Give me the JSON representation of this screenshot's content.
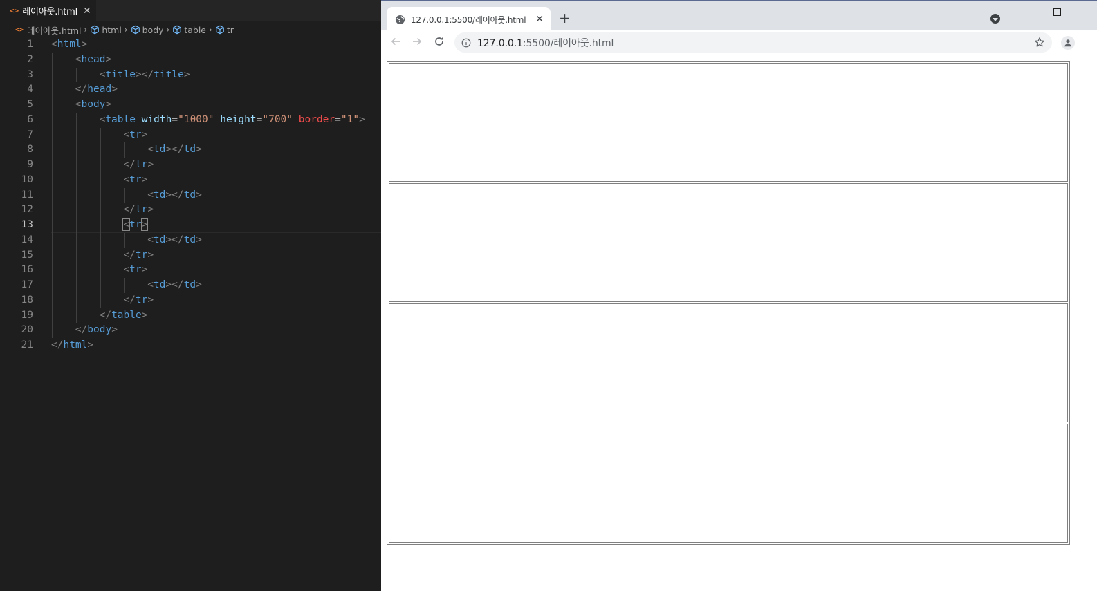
{
  "editor": {
    "tab": {
      "label": "레이아웃.html",
      "icon": "html-file-icon"
    },
    "breadcrumb": {
      "file": "레이아웃.html",
      "items": [
        "html",
        "body",
        "table",
        "tr"
      ]
    },
    "active_line": 13,
    "lines": [
      {
        "n": "1",
        "indent": 0,
        "tokens": [
          [
            "br",
            "<"
          ],
          [
            "tag",
            "html"
          ],
          [
            "br",
            ">"
          ]
        ]
      },
      {
        "n": "2",
        "indent": 1,
        "tokens": [
          [
            "br",
            "<"
          ],
          [
            "tag",
            "head"
          ],
          [
            "br",
            ">"
          ]
        ]
      },
      {
        "n": "3",
        "indent": 2,
        "tokens": [
          [
            "br",
            "<"
          ],
          [
            "tag",
            "title"
          ],
          [
            "br",
            "></"
          ],
          [
            "tag",
            "title"
          ],
          [
            "br",
            ">"
          ]
        ]
      },
      {
        "n": "4",
        "indent": 1,
        "tokens": [
          [
            "br",
            "</"
          ],
          [
            "tag",
            "head"
          ],
          [
            "br",
            ">"
          ]
        ]
      },
      {
        "n": "5",
        "indent": 1,
        "tokens": [
          [
            "br",
            "<"
          ],
          [
            "tag",
            "body"
          ],
          [
            "br",
            ">"
          ]
        ]
      },
      {
        "n": "6",
        "indent": 2,
        "tokens": [
          [
            "br",
            "<"
          ],
          [
            "tag",
            "table"
          ],
          [
            "sp",
            " "
          ],
          [
            "attr",
            "width"
          ],
          [
            "eq",
            "="
          ],
          [
            "val",
            "\"1000\""
          ],
          [
            "sp",
            " "
          ],
          [
            "attr",
            "height"
          ],
          [
            "eq",
            "="
          ],
          [
            "val",
            "\"700\""
          ],
          [
            "sp",
            " "
          ],
          [
            "attr-r",
            "border"
          ],
          [
            "eq",
            "="
          ],
          [
            "val",
            "\"1\""
          ],
          [
            "br",
            ">"
          ]
        ]
      },
      {
        "n": "7",
        "indent": 3,
        "tokens": [
          [
            "br",
            "<"
          ],
          [
            "tag",
            "tr"
          ],
          [
            "br",
            ">"
          ]
        ]
      },
      {
        "n": "8",
        "indent": 4,
        "tokens": [
          [
            "br",
            "<"
          ],
          [
            "tag",
            "td"
          ],
          [
            "br",
            "></"
          ],
          [
            "tag",
            "td"
          ],
          [
            "br",
            ">"
          ]
        ]
      },
      {
        "n": "9",
        "indent": 3,
        "tokens": [
          [
            "br",
            "</"
          ],
          [
            "tag",
            "tr"
          ],
          [
            "br",
            ">"
          ]
        ]
      },
      {
        "n": "10",
        "indent": 3,
        "tokens": [
          [
            "br",
            "<"
          ],
          [
            "tag",
            "tr"
          ],
          [
            "br",
            ">"
          ]
        ]
      },
      {
        "n": "11",
        "indent": 4,
        "tokens": [
          [
            "br",
            "<"
          ],
          [
            "tag",
            "td"
          ],
          [
            "br",
            "></"
          ],
          [
            "tag",
            "td"
          ],
          [
            "br",
            ">"
          ]
        ]
      },
      {
        "n": "12",
        "indent": 3,
        "tokens": [
          [
            "br",
            "</"
          ],
          [
            "tag",
            "tr"
          ],
          [
            "br",
            ">"
          ]
        ]
      },
      {
        "n": "13",
        "indent": 3,
        "tokens": [
          [
            "hbr",
            "<"
          ],
          [
            "tag",
            "tr"
          ],
          [
            "hbr",
            ">"
          ]
        ]
      },
      {
        "n": "14",
        "indent": 4,
        "tokens": [
          [
            "br",
            "<"
          ],
          [
            "tag",
            "td"
          ],
          [
            "br",
            "></"
          ],
          [
            "tag",
            "td"
          ],
          [
            "br",
            ">"
          ]
        ]
      },
      {
        "n": "15",
        "indent": 3,
        "tokens": [
          [
            "br",
            "</"
          ],
          [
            "tag",
            "tr"
          ],
          [
            "br",
            ">"
          ]
        ]
      },
      {
        "n": "16",
        "indent": 3,
        "tokens": [
          [
            "br",
            "<"
          ],
          [
            "tag",
            "tr"
          ],
          [
            "br",
            ">"
          ]
        ]
      },
      {
        "n": "17",
        "indent": 4,
        "tokens": [
          [
            "br",
            "<"
          ],
          [
            "tag",
            "td"
          ],
          [
            "br",
            "></"
          ],
          [
            "tag",
            "td"
          ],
          [
            "br",
            ">"
          ]
        ]
      },
      {
        "n": "18",
        "indent": 3,
        "tokens": [
          [
            "br",
            "</"
          ],
          [
            "tag",
            "tr"
          ],
          [
            "br",
            ">"
          ]
        ]
      },
      {
        "n": "19",
        "indent": 2,
        "tokens": [
          [
            "br",
            "</"
          ],
          [
            "tag",
            "table"
          ],
          [
            "br",
            ">"
          ]
        ]
      },
      {
        "n": "20",
        "indent": 1,
        "tokens": [
          [
            "br",
            "</"
          ],
          [
            "tag",
            "body"
          ],
          [
            "br",
            ">"
          ]
        ]
      },
      {
        "n": "21",
        "indent": 0,
        "tokens": [
          [
            "br",
            "</"
          ],
          [
            "tag",
            "html"
          ],
          [
            "br",
            ">"
          ]
        ]
      }
    ]
  },
  "browser": {
    "tab_title": "127.0.0.1:5500/레이아웃.html",
    "url_host": "127.0.0.1",
    "url_rest": ":5500/레이아웃.html",
    "table": {
      "rows": 4,
      "cols": 1
    }
  },
  "colors": {
    "editor_bg": "#1e1e1e",
    "tag": "#569cd6",
    "attribute": "#9cdcfe",
    "attribute_highlight": "#f14c4c",
    "string": "#ce9178",
    "bracket": "#808080"
  }
}
